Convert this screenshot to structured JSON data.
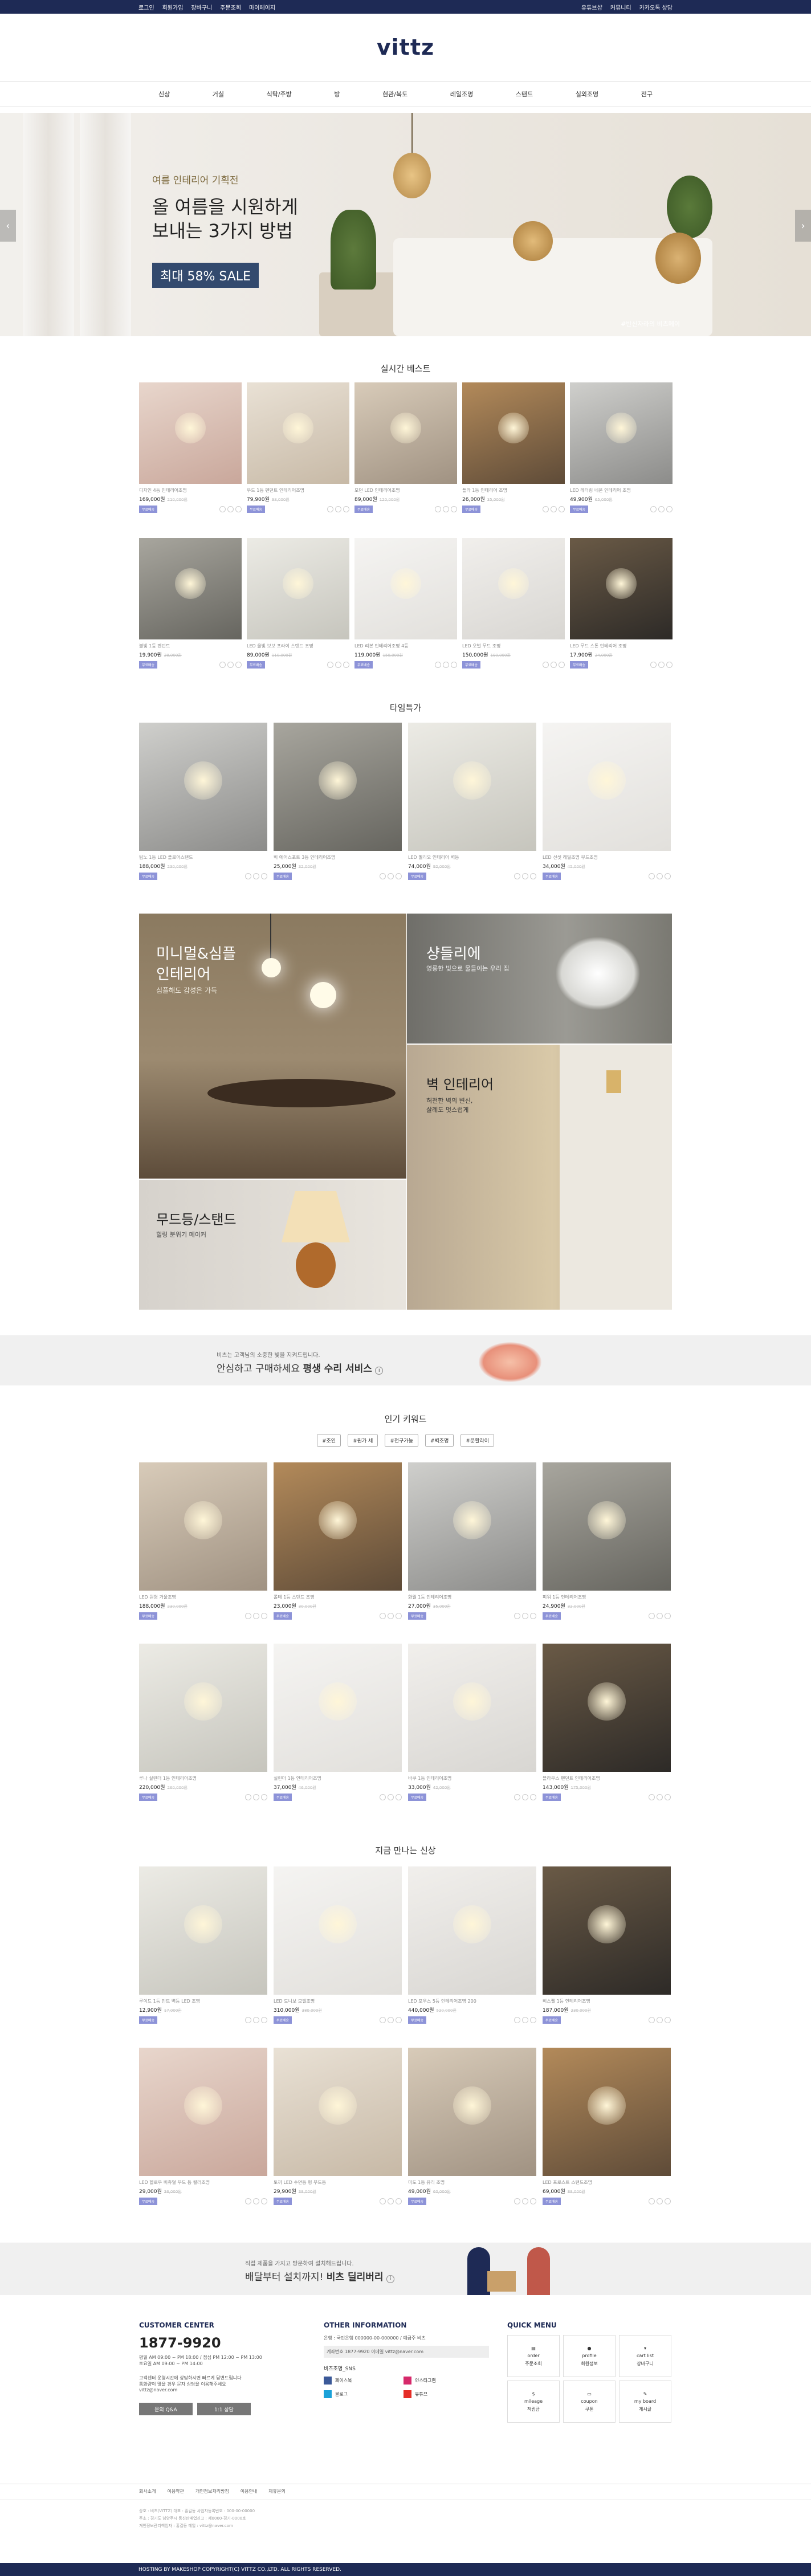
{
  "topbar": {
    "left": [
      "로그인",
      "회원가입",
      "장바구니",
      "주문조회",
      "마이페이지"
    ],
    "right": [
      "유튜브샵",
      "커뮤니티",
      "카카오톡 상담"
    ]
  },
  "brand": {
    "logo": "vittz"
  },
  "nav": [
    "신상",
    "거실",
    "식탁/주방",
    "방",
    "현관/복도",
    "레일조명",
    "스탠드",
    "실외조명",
    "전구"
  ],
  "hero": {
    "sub": "여름 인테리어 기획전",
    "line1": "올 여름을 시원하게",
    "line2": "보내는 3가지 방법",
    "sale": "최대 58% SALE",
    "tag": "#반신자라의 비츠메이"
  },
  "best": {
    "title": "실시간 베스트",
    "items": [
      {
        "name": "디자인 4등 인테리어조명",
        "price": "169,000원",
        "old": "210,000원"
      },
      {
        "name": "우드 1등 펜던트 인테리어조명",
        "price": "79,900원",
        "old": "98,000원"
      },
      {
        "name": "모던 LED 인테리어조명",
        "price": "89,000원",
        "old": "120,000원"
      },
      {
        "name": "플라 1등 인테리어 조명",
        "price": "26,000원",
        "old": "35,000원"
      },
      {
        "name": "LED 레터링 네온 인테리어 조명",
        "price": "49,900원",
        "old": "65,000원"
      },
      {
        "name": "볼빛 1등 펜던트",
        "price": "19,900원",
        "old": "28,000원"
      },
      {
        "name": "LED 올빛 보보 프라이 스탠드 조명",
        "price": "89,000원",
        "old": "110,000원"
      },
      {
        "name": "LED 리본 인테리어조명 4등",
        "price": "119,000원",
        "old": "150,000원"
      },
      {
        "name": "LED 오벌 무드 조명",
        "price": "150,000원",
        "old": "190,000원"
      },
      {
        "name": "LED 무드 스톤 인테리어 조명",
        "price": "17,900원",
        "old": "24,000원"
      }
    ]
  },
  "special": {
    "title": "타임특가",
    "items": [
      {
        "name": "팀노 1등 LED 플로어스탠드",
        "price": "188,000원",
        "old": "230,000원"
      },
      {
        "name": "빅 에어스포트 3등 인테리어조명",
        "price": "25,000원",
        "old": "32,000원"
      },
      {
        "name": "LED 벨리오 인테리어 벽등",
        "price": "74,000원",
        "old": "92,000원"
      },
      {
        "name": "LED 선셋 레일조명 무드조명",
        "price": "34,000원",
        "old": "45,000원"
      }
    ]
  },
  "categories": {
    "minimal": {
      "t1": "미니멀&심플",
      "t2": "인테리어",
      "sub": "심플해도 감성은 가득"
    },
    "chandelier": {
      "t": "샹들리에",
      "sub": "영롱한 빛으로 물들이는 우리 집"
    },
    "wall": {
      "t": "벽 인테리어",
      "sub1": "허전한 벽의 변신,",
      "sub2": "살레도 멋스럽게"
    },
    "mood": {
      "t": "무드등/스탠드",
      "sub": "힐링 분위기 메이커"
    }
  },
  "service": {
    "line1": "비츠는 고객님의 소중한 빛을 지켜드립니다.",
    "line2a": "안심하고 구매하세요 ",
    "line2b": "평생 수리 서비스"
  },
  "keywords": {
    "title": "인기 키워드",
    "tags": [
      "#조인",
      "#원가 세",
      "#전구가능",
      "#벽조명",
      "#분할라이"
    ],
    "items": [
      {
        "name": "LED 원형 거울조명",
        "price": "188,000원",
        "old": "230,000원"
      },
      {
        "name": "롤테 1등 스탠드 조명",
        "price": "23,000원",
        "old": "30,000원"
      },
      {
        "name": "화월 1등 인테리어조명",
        "price": "27,000원",
        "old": "35,000원"
      },
      {
        "name": "피워 1등 인테리어조명",
        "price": "24,900원",
        "old": "32,000원"
      },
      {
        "name": "루나 실린더 1등 인테리어조명",
        "price": "220,000원",
        "old": "260,000원"
      },
      {
        "name": "실린더 1등 인테리어조명",
        "price": "37,000원",
        "old": "46,000원"
      },
      {
        "name": "바쿠 1등 인테리어조명",
        "price": "33,000원",
        "old": "42,000원"
      },
      {
        "name": "블라우스 펜던트 인테리어조명",
        "price": "143,000원",
        "old": "175,000원"
      }
    ]
  },
  "newest": {
    "title": "지금 만나는 신상",
    "items": [
      {
        "name": "루이드 1등 인트 벽등 LED 조명",
        "price": "12,900원",
        "old": "17,000원"
      },
      {
        "name": "LED 도니보 모빌조명",
        "price": "310,000원",
        "old": "380,000원"
      },
      {
        "name": "LED 포우스 5등 인테리어조명 200",
        "price": "440,000원",
        "old": "520,000원"
      },
      {
        "name": "비스펠 1등 인테리어조명",
        "price": "187,000원",
        "old": "230,000원"
      },
      {
        "name": "LED 헬로우 비쥬얼 무드 등 컬러조명",
        "price": "29,000원",
        "old": "36,000원"
      },
      {
        "name": "토끼 LED 수면등 펑 무드등",
        "price": "29,900원",
        "old": "38,000원"
      },
      {
        "name": "미도 1등 유리 조명",
        "price": "49,000원",
        "old": "60,000원"
      },
      {
        "name": "LED 프로스트 스탠드조명",
        "price": "69,000원",
        "old": "88,000원"
      }
    ]
  },
  "delivery": {
    "line1": "직접 제품을 가지고 방문하여 설치해드립니다.",
    "line2a": "배달부터 설치까지! ",
    "line2b": "비츠 딜리버리"
  },
  "badge": "무료배송",
  "footer": {
    "cs": {
      "title": "CUSTOMER CENTER",
      "phone": "1877-9920",
      "hours": [
        "평일 AM 09:00 ~ PM 18:00 / 점심 PM 12:00 ~ PM 13:00",
        "토요일 AM 09:00 ~ PM 14:00"
      ],
      "notes": [
        "고객센터 운영시간에 상담하시면 빠르게 답변드립니다",
        "통화량이 많을 경우 문자 상담을 이용해주세요"
      ],
      "email": "vittz@naver.com",
      "btn1": "문의 Q&A",
      "btn2": "1:1 상담"
    },
    "info": {
      "title": "OTHER INFORMATION",
      "lines": [
        "은행 : 국민은행 000000-00-000000 / 예금주 비츠",
        "계좌번호 1877-9920 이메일 vittz@naver.com"
      ],
      "sns_title": "비즈조명_SNS",
      "sns": [
        "페이스북",
        "인스타그램",
        "블로그",
        "유튜브"
      ]
    },
    "quick": {
      "title": "QUICK MENU",
      "items": [
        "order",
        "profile",
        "cart list",
        "mileage",
        "coupon",
        "my board"
      ],
      "subs": [
        "주문조회",
        "회원정보",
        "장바구니",
        "적립금",
        "쿠폰",
        "게시글"
      ]
    },
    "links": [
      "회사소개",
      "이용약관",
      "개인정보처리방침",
      "이용안내",
      "제휴문의"
    ],
    "company": [
      "상호 : 비츠(VITTZ) 대표 : 홍길동 사업자등록번호 : 000-00-00000",
      "주소 : 경기도 남양주시 통신판매업신고 : 제0000-경기-0000호",
      "개인정보관리책임자 : 홍길동 메일 : vittz@naver.com"
    ],
    "copy": "HOSTING BY MAKESHOP COPYRIGHT(C) VITTZ CO.,LTD. ALL RIGHTS RESERVED."
  }
}
